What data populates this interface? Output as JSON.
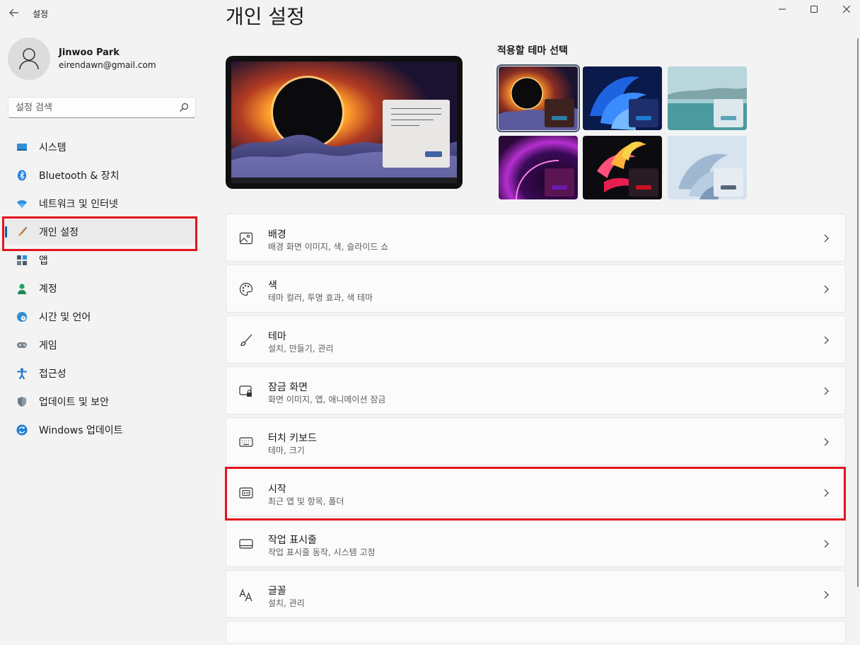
{
  "window": {
    "app_title": "설정"
  },
  "user": {
    "name": "Jinwoo Park",
    "email": "eirendawn@gmail.com"
  },
  "search": {
    "placeholder": "설정 검색"
  },
  "sidebar": {
    "items": [
      {
        "label": "시스템",
        "icon": "system-icon"
      },
      {
        "label": "Bluetooth & 장치",
        "icon": "bluetooth-icon"
      },
      {
        "label": "네트워크 및 인터넷",
        "icon": "wifi-icon"
      },
      {
        "label": "개인 설정",
        "icon": "brush-icon",
        "active": true
      },
      {
        "label": "앱",
        "icon": "apps-icon"
      },
      {
        "label": "계정",
        "icon": "account-icon"
      },
      {
        "label": "시간 및 언어",
        "icon": "globe-clock-icon"
      },
      {
        "label": "게임",
        "icon": "gamepad-icon"
      },
      {
        "label": "접근성",
        "icon": "accessibility-icon"
      },
      {
        "label": "업데이트 및 보안",
        "icon": "shield-icon"
      },
      {
        "label": "Windows 업데이트",
        "icon": "sync-icon"
      }
    ]
  },
  "main": {
    "page_title": "개인 설정",
    "themes_title": "적용할 테마 선택",
    "themes": [
      {
        "name": "eclipse",
        "selected": true,
        "mini_color": "#3d2320",
        "bar_color": "#2f7ca8"
      },
      {
        "name": "windows-bloom-blue",
        "selected": false,
        "mini_color": "#1f2f6c",
        "bar_color": "#1d7ad1"
      },
      {
        "name": "lake",
        "selected": false,
        "mini_color": "#dce8ec",
        "bar_color": "#5ea3b8"
      },
      {
        "name": "purple-glow",
        "selected": false,
        "mini_color": "#5a1552",
        "bar_color": "#6a1bb0"
      },
      {
        "name": "flower",
        "selected": false,
        "mini_color": "#2a1c24",
        "bar_color": "#d01020"
      },
      {
        "name": "windows-bloom-light",
        "selected": false,
        "mini_color": "#e6ecf2",
        "bar_color": "#56667a"
      }
    ],
    "settings": [
      {
        "title": "배경",
        "subtitle": "배경 화면 이미지, 색, 슬라이드 쇼",
        "icon": "image-icon"
      },
      {
        "title": "색",
        "subtitle": "테마 컬러, 투명 효과, 색 테마",
        "icon": "palette-icon"
      },
      {
        "title": "테마",
        "subtitle": "설치, 만들기, 관리",
        "icon": "brush-icon"
      },
      {
        "title": "잠금 화면",
        "subtitle": "화면 이미지, 앱, 애니메이션 잠금",
        "icon": "lock-screen-icon"
      },
      {
        "title": "터치 키보드",
        "subtitle": "테마, 크기",
        "icon": "keyboard-icon"
      },
      {
        "title": "시작",
        "subtitle": "최근 앱 및 항목, 폴더",
        "icon": "start-icon",
        "highlighted": true
      },
      {
        "title": "작업 표시줄",
        "subtitle": "작업 표시줄 동작, 시스템 고정",
        "icon": "taskbar-icon"
      },
      {
        "title": "글꼴",
        "subtitle": "설치, 관리",
        "icon": "font-icon"
      }
    ]
  },
  "colors": {
    "accent": "#005fb8",
    "highlight_box": "#e3131c",
    "window_bg": "#f3f3f3",
    "card_bg": "#fbfbfb"
  }
}
